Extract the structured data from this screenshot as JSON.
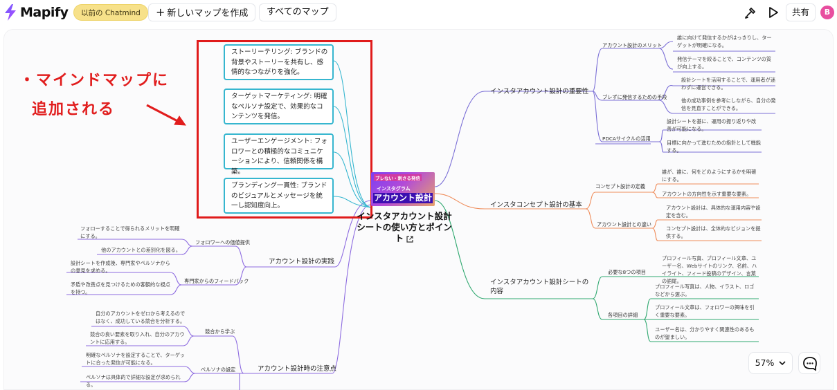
{
  "topbar": {
    "brand": "Mapify",
    "old_button": "以前の Chatmind",
    "new_map_button": "新しいマップを作成",
    "all_maps_button": "すべてのマップ",
    "share_button": "共有",
    "avatar_initial": "B"
  },
  "annotation": {
    "line1": "・マインドマップに",
    "line2": "追加される"
  },
  "root": {
    "title": "インスタアカウント設計シートの使い方とポイント",
    "image_top": "ブレない・刺さる発信",
    "image_mid": "インスタグラム",
    "image_main": "アカウント設計"
  },
  "cards": [
    "ストーリーテリング: ブランドの背景やストーリーを共有し、感情的なつながりを強化。",
    "ターゲットマーケティング: 明確なペルソナ設定で、効果的なコンテンツを発信。",
    "ユーザーエンゲージメント: フォロワーとの積極的なコミュニケーションにより、信頼関係を構築。",
    "ブランディング一貫性: ブランドのビジュアルとメッセージを統一し認知度向上。"
  ],
  "right": {
    "b1": {
      "label": "インスタアカウント設計の重要性",
      "s1": "アカウント設計のメリット",
      "s1_l1": "誰に向けて発信するかがはっきりし、ターゲットが明確になる。",
      "s1_l2": "発信テーマを絞ることで、コンテンツの質が向上する。",
      "s2": "ブレずに発信するための手段",
      "s2_l1": "設計シートを活用することで、運用者が迷わずに運営できる。",
      "s2_l2": "他の成功事例を参考にしながら、自分の発信を見直すことができる。",
      "s3": "PDCAサイクルの活用",
      "s3_l1": "設計シートを基に、運用の振り返りや改善が可能になる。",
      "s3_l2": "目標に向かって進むための指針として機能する。"
    },
    "b2": {
      "label": "インスタコンセプト設計の基本",
      "s1": "コンセプト設計の定義",
      "s1_l1": "誰が、誰に、何をどのようにするかを明確にする。",
      "s1_l2": "アカウントの方向性を示す重要な要素。",
      "s2": "アカウント設計との違い",
      "s2_l1": "アカウント設計は、具体的な運用内容や設定を含む。",
      "s2_l2": "コンセプト設計は、全体的なビジョンを提供する。"
    },
    "b3": {
      "label": "インスタアカウント設計シートの内容",
      "s1": "必要な8つの項目",
      "s1_l1": "プロフィール写真、プロフィール文章、ユーザー名、Webサイトのリンク、名前、ハイライト、フィード投稿のデザイン、言葉の語尾。",
      "s2": "各項目の詳細",
      "s2_l1": "プロフィール写真は、人物、イラスト、ロゴなどから選ぶ。",
      "s2_l2": "プロフィール文章は、フォロワーの興味を引く重要な要素。",
      "s2_l3": "ユーザー名は、分かりやすく関連性のあるものが望ましい。"
    }
  },
  "left": {
    "b1": {
      "label": "アカウント設計の実践",
      "s1": "フォロワーへの価値提供",
      "s1_l1": "フォローすることで得られるメリットを明確にする。",
      "s1_l2": "他のアカウントとの差別化を図る。",
      "s2": "専門家からのフィードバック",
      "s2_l1": "設計シートを作成後、専門家やペルソナからの意見を求める。",
      "s2_l2": "矛盾や改善点を見つけるための客観的な視点を持つ。"
    },
    "b2": {
      "label": "アカウント設計時の注意点",
      "s1": "競合から学ぶ",
      "s1_l1": "自分のアカウントをゼロから考えるのではなく、成功している競合を分析する。",
      "s1_l2": "競合の良い要素を取り入れ、自分のアカウントに応用する。",
      "s2": "ペルソナの設定",
      "s2_l1": "明確なペルソナを設定することで、ターゲットに合った発信が可能になる。",
      "s2_l2": "ペルソナは具体的で詳細な設定が求められる。"
    }
  },
  "zoom": {
    "level": "57%"
  },
  "colors": {
    "purple": "#7b6fd6",
    "orange": "#ef8c5a",
    "green": "#2fa86f",
    "violet": "#8d6be0",
    "cyan": "#36b6cf",
    "highlight": "#e01b1b"
  }
}
